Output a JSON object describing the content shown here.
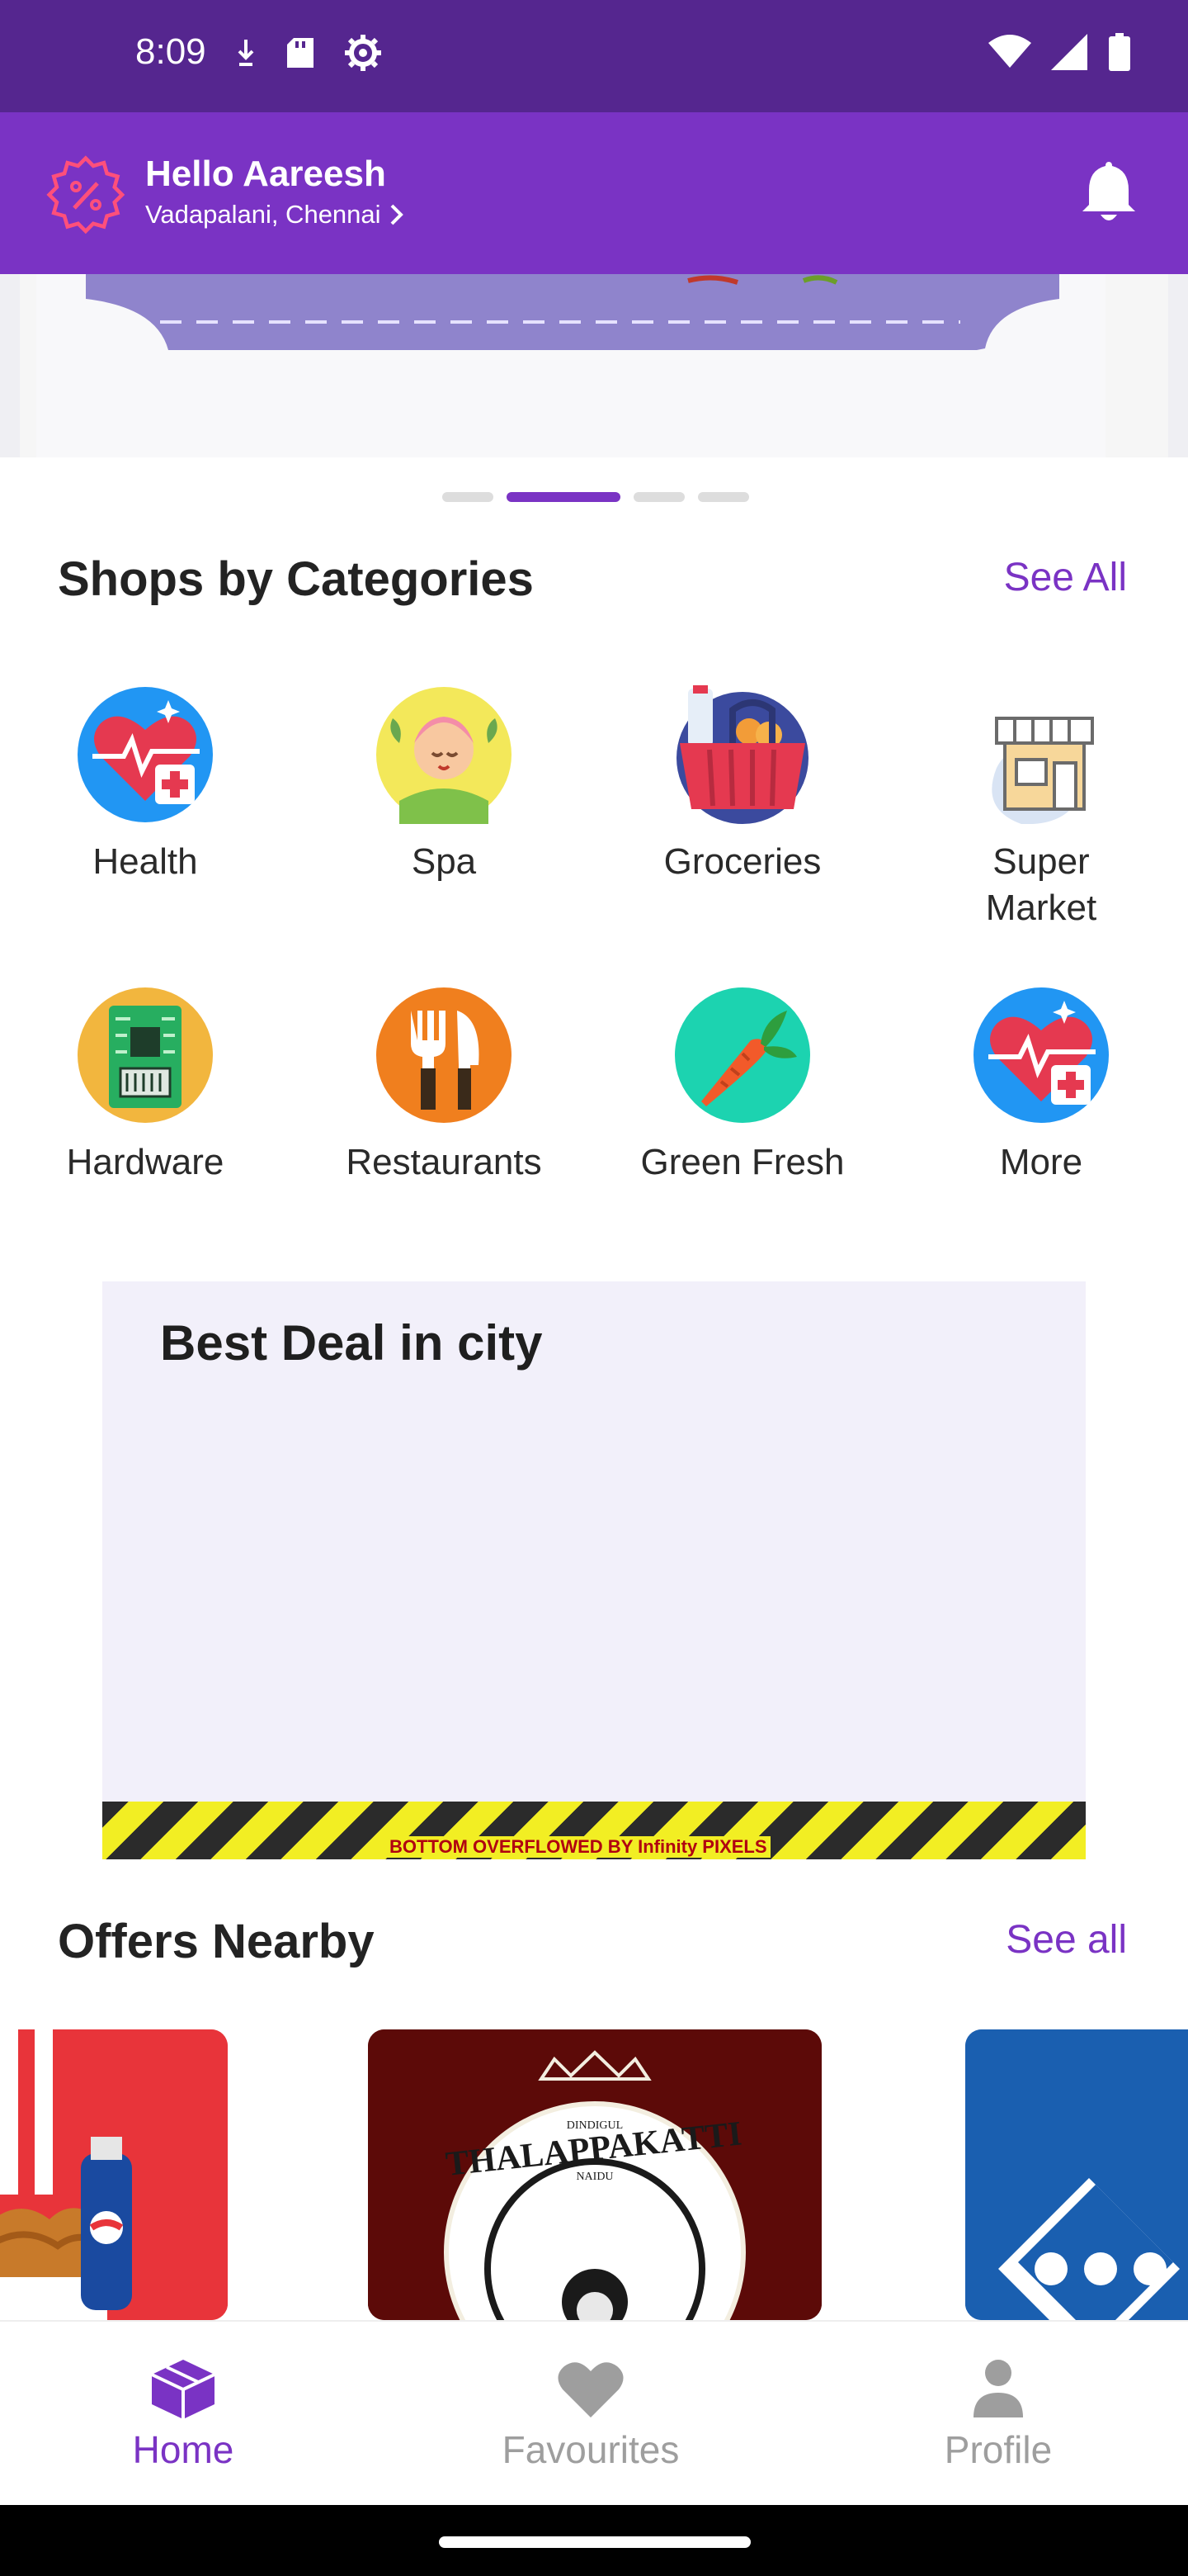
{
  "status_bar": {
    "time": "8:09",
    "left_icons": [
      "download-icon",
      "sd-card-icon",
      "settings-gear-icon"
    ],
    "right_icons": [
      "wifi-icon",
      "signal-icon",
      "battery-icon"
    ],
    "background": "#55268f"
  },
  "header": {
    "greeting": "Hello Aareesh",
    "location": "Vadapalani, Chennai",
    "icons": [
      "offer-badge-icon",
      "bell-icon"
    ],
    "background": "#7a33c4"
  },
  "carousel": {
    "page_count": 4,
    "active_index": 1
  },
  "categories": {
    "title": "Shops by Categories",
    "see_all_label": "See All",
    "items": [
      {
        "label": "Health",
        "icon": "heart-health-icon"
      },
      {
        "label": "Spa",
        "icon": "spa-icon"
      },
      {
        "label": "Groceries",
        "icon": "grocery-basket-icon"
      },
      {
        "label": "Super Market",
        "icon": "supermarket-store-icon"
      },
      {
        "label": "Hardware",
        "icon": "circuit-board-icon"
      },
      {
        "label": "Restaurants",
        "icon": "fork-knife-icon"
      },
      {
        "label": "Green Fresh",
        "icon": "carrot-icon"
      },
      {
        "label": "More",
        "icon": "heart-health-icon"
      }
    ]
  },
  "deal": {
    "title": "Best Deal in city",
    "overflow_text": "BOTTOM OVERFLOWED BY Infinity PIXELS"
  },
  "offers": {
    "title": "Offers Nearby",
    "see_all_label": "See all",
    "cards": [
      {
        "name": "kfc-offer-card",
        "icon": "fried-chicken-bucket-image"
      },
      {
        "name": "thalappakatti-offer-card",
        "icon": "thalappakatti-logo-image",
        "logo_text": [
          "DINDIGUL",
          "THALAPPAKATTI",
          "NAIDU"
        ]
      },
      {
        "name": "dominos-offer-card",
        "icon": "dominos-logo-image"
      }
    ]
  },
  "bottom_nav": {
    "items": [
      {
        "label": "Home",
        "icon": "home-box-icon",
        "active": true
      },
      {
        "label": "Favourites",
        "icon": "heart-icon",
        "active": false
      },
      {
        "label": "Profile",
        "icon": "person-icon",
        "active": false
      }
    ],
    "active_color": "#7a33c4",
    "inactive_color": "#9e9e9e"
  },
  "colors": {
    "accent": "#7a33c4",
    "status_bar": "#55268f",
    "deal_background": "#f2f0fa"
  }
}
